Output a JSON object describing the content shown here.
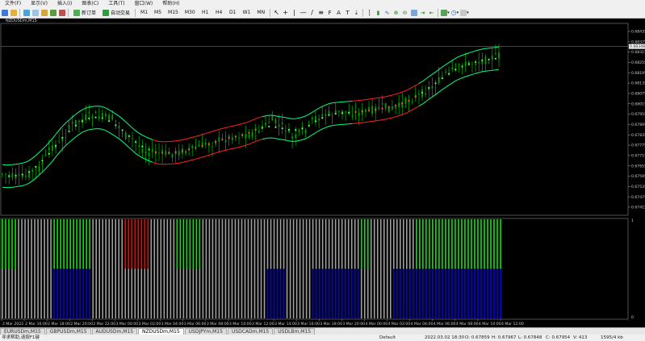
{
  "menu": [
    "文件(F)",
    "显示(V)",
    "插入(I)",
    "图表(C)",
    "工具(T)",
    "窗口(W)",
    "帮助(H)"
  ],
  "toolbar": {
    "new_order_label": "新订单",
    "autotrading_label": "自动交易",
    "timeframes": [
      "M1",
      "M5",
      "M15",
      "M30",
      "H1",
      "H4",
      "D1",
      "W1",
      "MN"
    ]
  },
  "chart": {
    "title": "NZDUSDm,M15",
    "indicator_title": "",
    "price_labels": [
      "0.68435",
      "0.68375",
      "0.68315",
      "0.68255",
      "0.68195",
      "0.68135",
      "0.68075",
      "0.68015",
      "0.67955",
      "0.67895",
      "0.67835",
      "0.67775",
      "0.67715",
      "0.67655",
      "0.67595",
      "0.67535",
      "0.67475",
      "0.67415"
    ],
    "current_price": "0.68348",
    "indicator_labels": [
      "1",
      "0"
    ],
    "time_labels": [
      "2 Mar 2022",
      "2 Mar 16:00",
      "2 Mar 18:00",
      "2 Mar 20:00",
      "2 Mar 22:00",
      "3 Mar 00:00",
      "3 Mar 02:00",
      "3 Mar 04:00",
      "3 Mar 06:00",
      "3 Mar 08:00",
      "3 Mar 10:00",
      "3 Mar 12:00",
      "3 Mar 14:00",
      "3 Mar 16:00",
      "3 Mar 18:00",
      "3 Mar 20:00",
      "4 Mar 00:00",
      "4 Mar 02:00",
      "4 Mar 04:00",
      "4 Mar 06:00",
      "4 Mar 08:00",
      "4 Mar 10:00",
      "4 Mar 12:00"
    ],
    "colors": {
      "candle": "#00a000",
      "band_up": "#00ff80",
      "band_down": "#ff2020",
      "dots_up": "#55ff55",
      "dots_down": "#ff5050",
      "hist_gray": "#a0a0a0",
      "hist_green": "#00ee00",
      "hist_red": "#ff0000",
      "hist_blue": "#0000ff",
      "grid": "#555555"
    }
  },
  "tabs": [
    "EURUSDm,M15",
    "GBPUSDm,M15",
    "AUDUSDm,M15",
    "NZDUSDm,M15",
    "USDJPYm,M15",
    "USDCADm,M15",
    "USDLBm,M15"
  ],
  "active_tab": "NZDUSDm,M15",
  "status": {
    "help": "寻求帮助,请按F1键",
    "profile": "Default",
    "time": "2022.03.02 18:30",
    "open": "O: 0.67859",
    "high": "H: 0.67967",
    "low": "L: 0.67848",
    "close": "C: 0.67954",
    "volume": "V: 413",
    "traffic": "1595/4 kb"
  }
}
